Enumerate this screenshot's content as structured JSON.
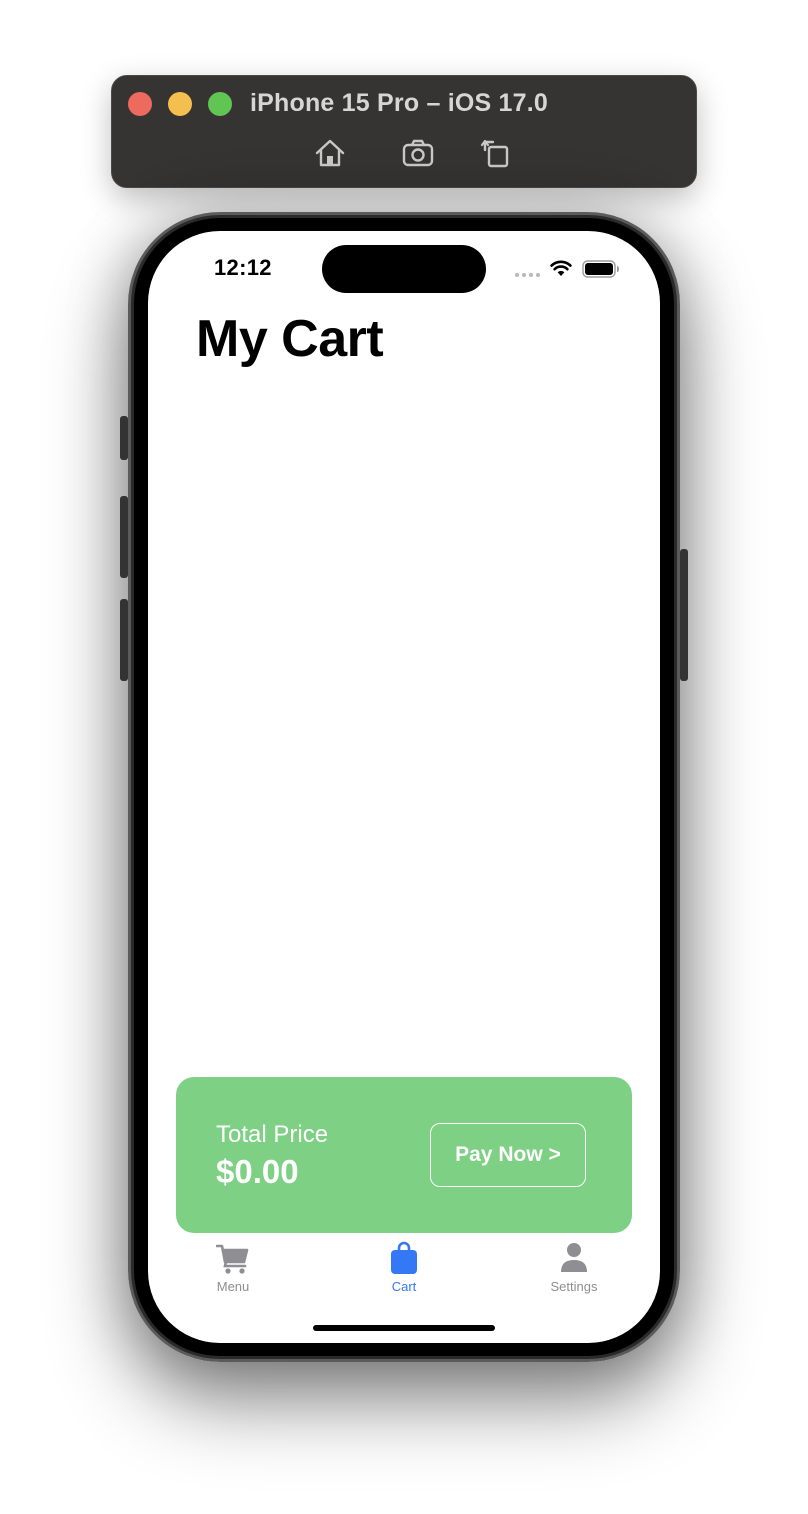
{
  "simulator": {
    "title": "iPhone 15 Pro – iOS 17.0",
    "toolbar_icons": [
      "home-icon",
      "screenshot-icon",
      "rotate-icon"
    ]
  },
  "status_bar": {
    "time": "12:12",
    "icons": [
      "cellular-dots-icon",
      "wifi-icon",
      "battery-icon"
    ]
  },
  "page": {
    "title": "My Cart"
  },
  "checkout": {
    "total_label": "Total Price",
    "total_value": "$0.00",
    "pay_label": "Pay Now >"
  },
  "tab_bar": {
    "items": [
      {
        "label": "Menu",
        "icon": "cart-icon",
        "selected": false
      },
      {
        "label": "Cart",
        "icon": "bag-icon",
        "selected": true
      },
      {
        "label": "Settings",
        "icon": "person-icon",
        "selected": false
      }
    ]
  },
  "colors": {
    "checkout_card": "#7ed084",
    "tab_selected": "#3478f6",
    "tab_unselected": "#8e8e93",
    "simulator_bar": "#353433"
  }
}
